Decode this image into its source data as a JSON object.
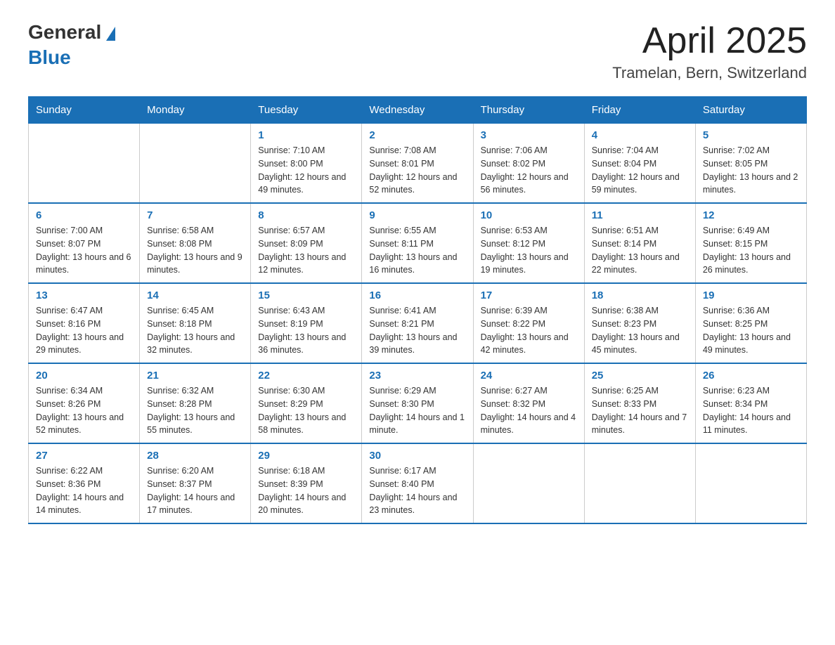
{
  "header": {
    "logo_general": "General",
    "logo_blue": "Blue",
    "month_year": "April 2025",
    "location": "Tramelan, Bern, Switzerland"
  },
  "weekdays": [
    "Sunday",
    "Monday",
    "Tuesday",
    "Wednesday",
    "Thursday",
    "Friday",
    "Saturday"
  ],
  "weeks": [
    [
      {
        "day": "",
        "sunrise": "",
        "sunset": "",
        "daylight": ""
      },
      {
        "day": "",
        "sunrise": "",
        "sunset": "",
        "daylight": ""
      },
      {
        "day": "1",
        "sunrise": "Sunrise: 7:10 AM",
        "sunset": "Sunset: 8:00 PM",
        "daylight": "Daylight: 12 hours and 49 minutes."
      },
      {
        "day": "2",
        "sunrise": "Sunrise: 7:08 AM",
        "sunset": "Sunset: 8:01 PM",
        "daylight": "Daylight: 12 hours and 52 minutes."
      },
      {
        "day": "3",
        "sunrise": "Sunrise: 7:06 AM",
        "sunset": "Sunset: 8:02 PM",
        "daylight": "Daylight: 12 hours and 56 minutes."
      },
      {
        "day": "4",
        "sunrise": "Sunrise: 7:04 AM",
        "sunset": "Sunset: 8:04 PM",
        "daylight": "Daylight: 12 hours and 59 minutes."
      },
      {
        "day": "5",
        "sunrise": "Sunrise: 7:02 AM",
        "sunset": "Sunset: 8:05 PM",
        "daylight": "Daylight: 13 hours and 2 minutes."
      }
    ],
    [
      {
        "day": "6",
        "sunrise": "Sunrise: 7:00 AM",
        "sunset": "Sunset: 8:07 PM",
        "daylight": "Daylight: 13 hours and 6 minutes."
      },
      {
        "day": "7",
        "sunrise": "Sunrise: 6:58 AM",
        "sunset": "Sunset: 8:08 PM",
        "daylight": "Daylight: 13 hours and 9 minutes."
      },
      {
        "day": "8",
        "sunrise": "Sunrise: 6:57 AM",
        "sunset": "Sunset: 8:09 PM",
        "daylight": "Daylight: 13 hours and 12 minutes."
      },
      {
        "day": "9",
        "sunrise": "Sunrise: 6:55 AM",
        "sunset": "Sunset: 8:11 PM",
        "daylight": "Daylight: 13 hours and 16 minutes."
      },
      {
        "day": "10",
        "sunrise": "Sunrise: 6:53 AM",
        "sunset": "Sunset: 8:12 PM",
        "daylight": "Daylight: 13 hours and 19 minutes."
      },
      {
        "day": "11",
        "sunrise": "Sunrise: 6:51 AM",
        "sunset": "Sunset: 8:14 PM",
        "daylight": "Daylight: 13 hours and 22 minutes."
      },
      {
        "day": "12",
        "sunrise": "Sunrise: 6:49 AM",
        "sunset": "Sunset: 8:15 PM",
        "daylight": "Daylight: 13 hours and 26 minutes."
      }
    ],
    [
      {
        "day": "13",
        "sunrise": "Sunrise: 6:47 AM",
        "sunset": "Sunset: 8:16 PM",
        "daylight": "Daylight: 13 hours and 29 minutes."
      },
      {
        "day": "14",
        "sunrise": "Sunrise: 6:45 AM",
        "sunset": "Sunset: 8:18 PM",
        "daylight": "Daylight: 13 hours and 32 minutes."
      },
      {
        "day": "15",
        "sunrise": "Sunrise: 6:43 AM",
        "sunset": "Sunset: 8:19 PM",
        "daylight": "Daylight: 13 hours and 36 minutes."
      },
      {
        "day": "16",
        "sunrise": "Sunrise: 6:41 AM",
        "sunset": "Sunset: 8:21 PM",
        "daylight": "Daylight: 13 hours and 39 minutes."
      },
      {
        "day": "17",
        "sunrise": "Sunrise: 6:39 AM",
        "sunset": "Sunset: 8:22 PM",
        "daylight": "Daylight: 13 hours and 42 minutes."
      },
      {
        "day": "18",
        "sunrise": "Sunrise: 6:38 AM",
        "sunset": "Sunset: 8:23 PM",
        "daylight": "Daylight: 13 hours and 45 minutes."
      },
      {
        "day": "19",
        "sunrise": "Sunrise: 6:36 AM",
        "sunset": "Sunset: 8:25 PM",
        "daylight": "Daylight: 13 hours and 49 minutes."
      }
    ],
    [
      {
        "day": "20",
        "sunrise": "Sunrise: 6:34 AM",
        "sunset": "Sunset: 8:26 PM",
        "daylight": "Daylight: 13 hours and 52 minutes."
      },
      {
        "day": "21",
        "sunrise": "Sunrise: 6:32 AM",
        "sunset": "Sunset: 8:28 PM",
        "daylight": "Daylight: 13 hours and 55 minutes."
      },
      {
        "day": "22",
        "sunrise": "Sunrise: 6:30 AM",
        "sunset": "Sunset: 8:29 PM",
        "daylight": "Daylight: 13 hours and 58 minutes."
      },
      {
        "day": "23",
        "sunrise": "Sunrise: 6:29 AM",
        "sunset": "Sunset: 8:30 PM",
        "daylight": "Daylight: 14 hours and 1 minute."
      },
      {
        "day": "24",
        "sunrise": "Sunrise: 6:27 AM",
        "sunset": "Sunset: 8:32 PM",
        "daylight": "Daylight: 14 hours and 4 minutes."
      },
      {
        "day": "25",
        "sunrise": "Sunrise: 6:25 AM",
        "sunset": "Sunset: 8:33 PM",
        "daylight": "Daylight: 14 hours and 7 minutes."
      },
      {
        "day": "26",
        "sunrise": "Sunrise: 6:23 AM",
        "sunset": "Sunset: 8:34 PM",
        "daylight": "Daylight: 14 hours and 11 minutes."
      }
    ],
    [
      {
        "day": "27",
        "sunrise": "Sunrise: 6:22 AM",
        "sunset": "Sunset: 8:36 PM",
        "daylight": "Daylight: 14 hours and 14 minutes."
      },
      {
        "day": "28",
        "sunrise": "Sunrise: 6:20 AM",
        "sunset": "Sunset: 8:37 PM",
        "daylight": "Daylight: 14 hours and 17 minutes."
      },
      {
        "day": "29",
        "sunrise": "Sunrise: 6:18 AM",
        "sunset": "Sunset: 8:39 PM",
        "daylight": "Daylight: 14 hours and 20 minutes."
      },
      {
        "day": "30",
        "sunrise": "Sunrise: 6:17 AM",
        "sunset": "Sunset: 8:40 PM",
        "daylight": "Daylight: 14 hours and 23 minutes."
      },
      {
        "day": "",
        "sunrise": "",
        "sunset": "",
        "daylight": ""
      },
      {
        "day": "",
        "sunrise": "",
        "sunset": "",
        "daylight": ""
      },
      {
        "day": "",
        "sunrise": "",
        "sunset": "",
        "daylight": ""
      }
    ]
  ]
}
